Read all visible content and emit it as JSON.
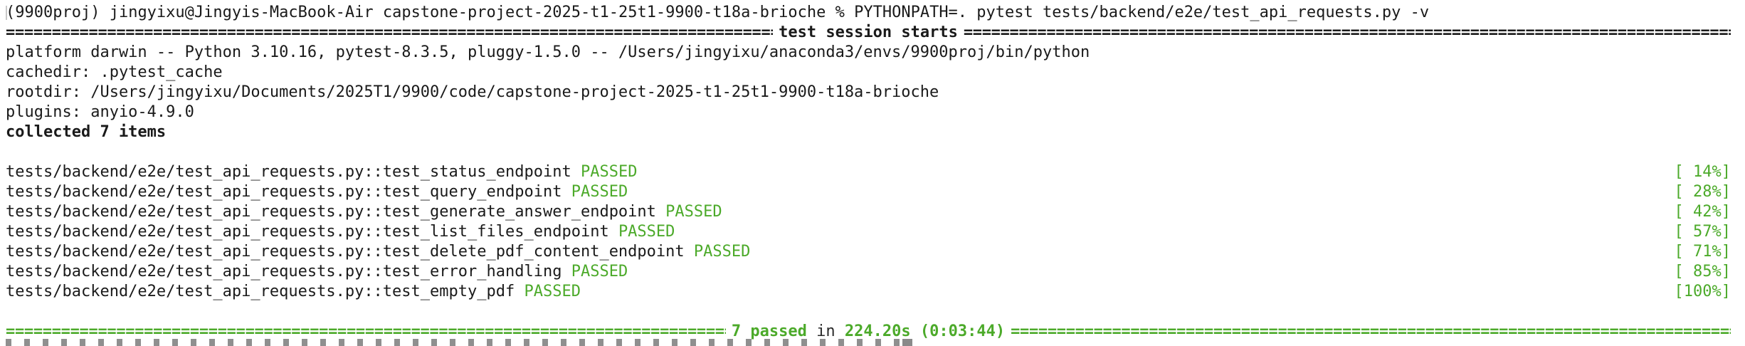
{
  "prompt": {
    "env": "(9900proj)",
    "user_host": "jingyixu@Jingyis-MacBook-Air",
    "cwd": "capstone-project-2025-t1-25t1-9900-t18a-brioche",
    "symbol": "%",
    "command": "PYTHONPATH=. pytest tests/backend/e2e/test_api_requests.py -v"
  },
  "session_header": {
    "rule_char": "=",
    "title": "test session starts"
  },
  "info_lines": [
    "platform darwin -- Python 3.10.16, pytest-8.3.5, pluggy-1.5.0 -- /Users/jingyixu/anaconda3/envs/9900proj/bin/python",
    "cachedir: .pytest_cache",
    "rootdir: /Users/jingyixu/Documents/2025T1/9900/code/capstone-project-2025-t1-25t1-9900-t18a-brioche",
    "plugins: anyio-4.9.0"
  ],
  "collected": "collected 7 items",
  "tests": [
    {
      "name": "tests/backend/e2e/test_api_requests.py::test_status_endpoint",
      "status": "PASSED",
      "progress": "[ 14%]"
    },
    {
      "name": "tests/backend/e2e/test_api_requests.py::test_query_endpoint",
      "status": "PASSED",
      "progress": "[ 28%]"
    },
    {
      "name": "tests/backend/e2e/test_api_requests.py::test_generate_answer_endpoint",
      "status": "PASSED",
      "progress": "[ 42%]"
    },
    {
      "name": "tests/backend/e2e/test_api_requests.py::test_list_files_endpoint",
      "status": "PASSED",
      "progress": "[ 57%]"
    },
    {
      "name": "tests/backend/e2e/test_api_requests.py::test_delete_pdf_content_endpoint",
      "status": "PASSED",
      "progress": "[ 71%]"
    },
    {
      "name": "tests/backend/e2e/test_api_requests.py::test_error_handling",
      "status": "PASSED",
      "progress": "[ 85%]"
    },
    {
      "name": "tests/backend/e2e/test_api_requests.py::test_empty_pdf",
      "status": "PASSED",
      "progress": "[100%]"
    }
  ],
  "summary": {
    "passed": "7 passed",
    "in": "in",
    "duration": "224.20s (0:03:44)"
  },
  "colors": {
    "background": "#ffffff",
    "text": "#1a1a1a",
    "pass_green": "#4caa2a"
  }
}
